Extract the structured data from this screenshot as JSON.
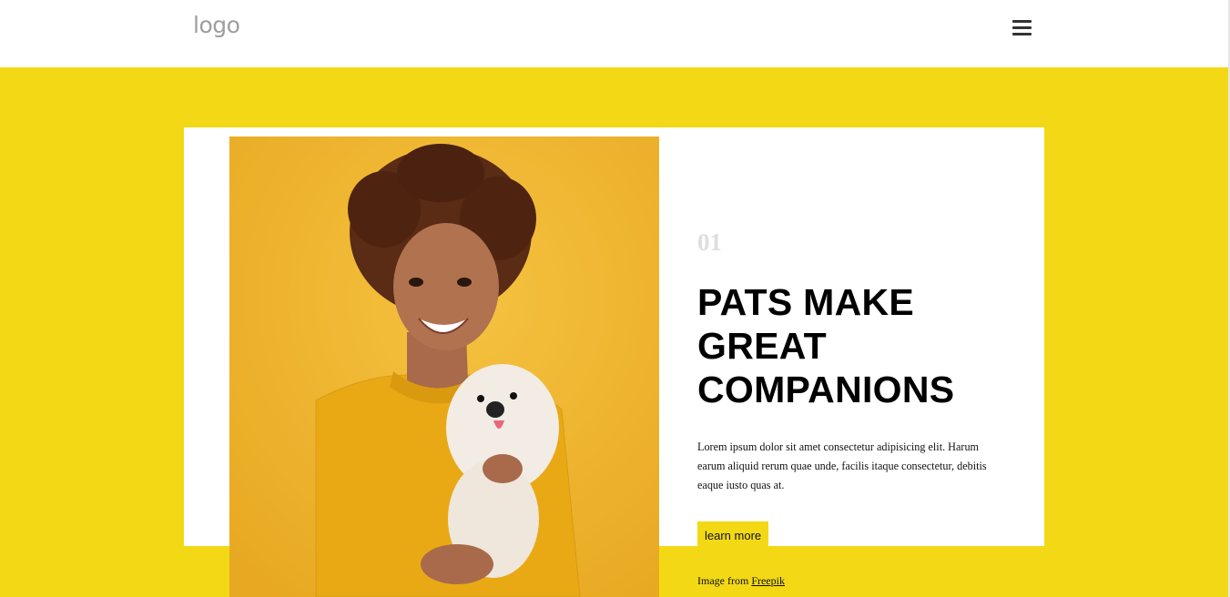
{
  "header": {
    "logo_text": "logo",
    "menu_icon": "hamburger-menu-icon"
  },
  "hero": {
    "background_color": "#f3d915",
    "slide_number": "01",
    "title": "PATS MAKE GREAT COMPANIONS",
    "description": "Lorem ipsum dolor sit amet consectetur adipisicing elit. Harum earum aliquid rerum quae unde, facilis itaque consectetur, debitis eaque iusto quas at.",
    "cta_label": "learn more",
    "credit_prefix": "Image from ",
    "credit_link": "Freepik"
  }
}
